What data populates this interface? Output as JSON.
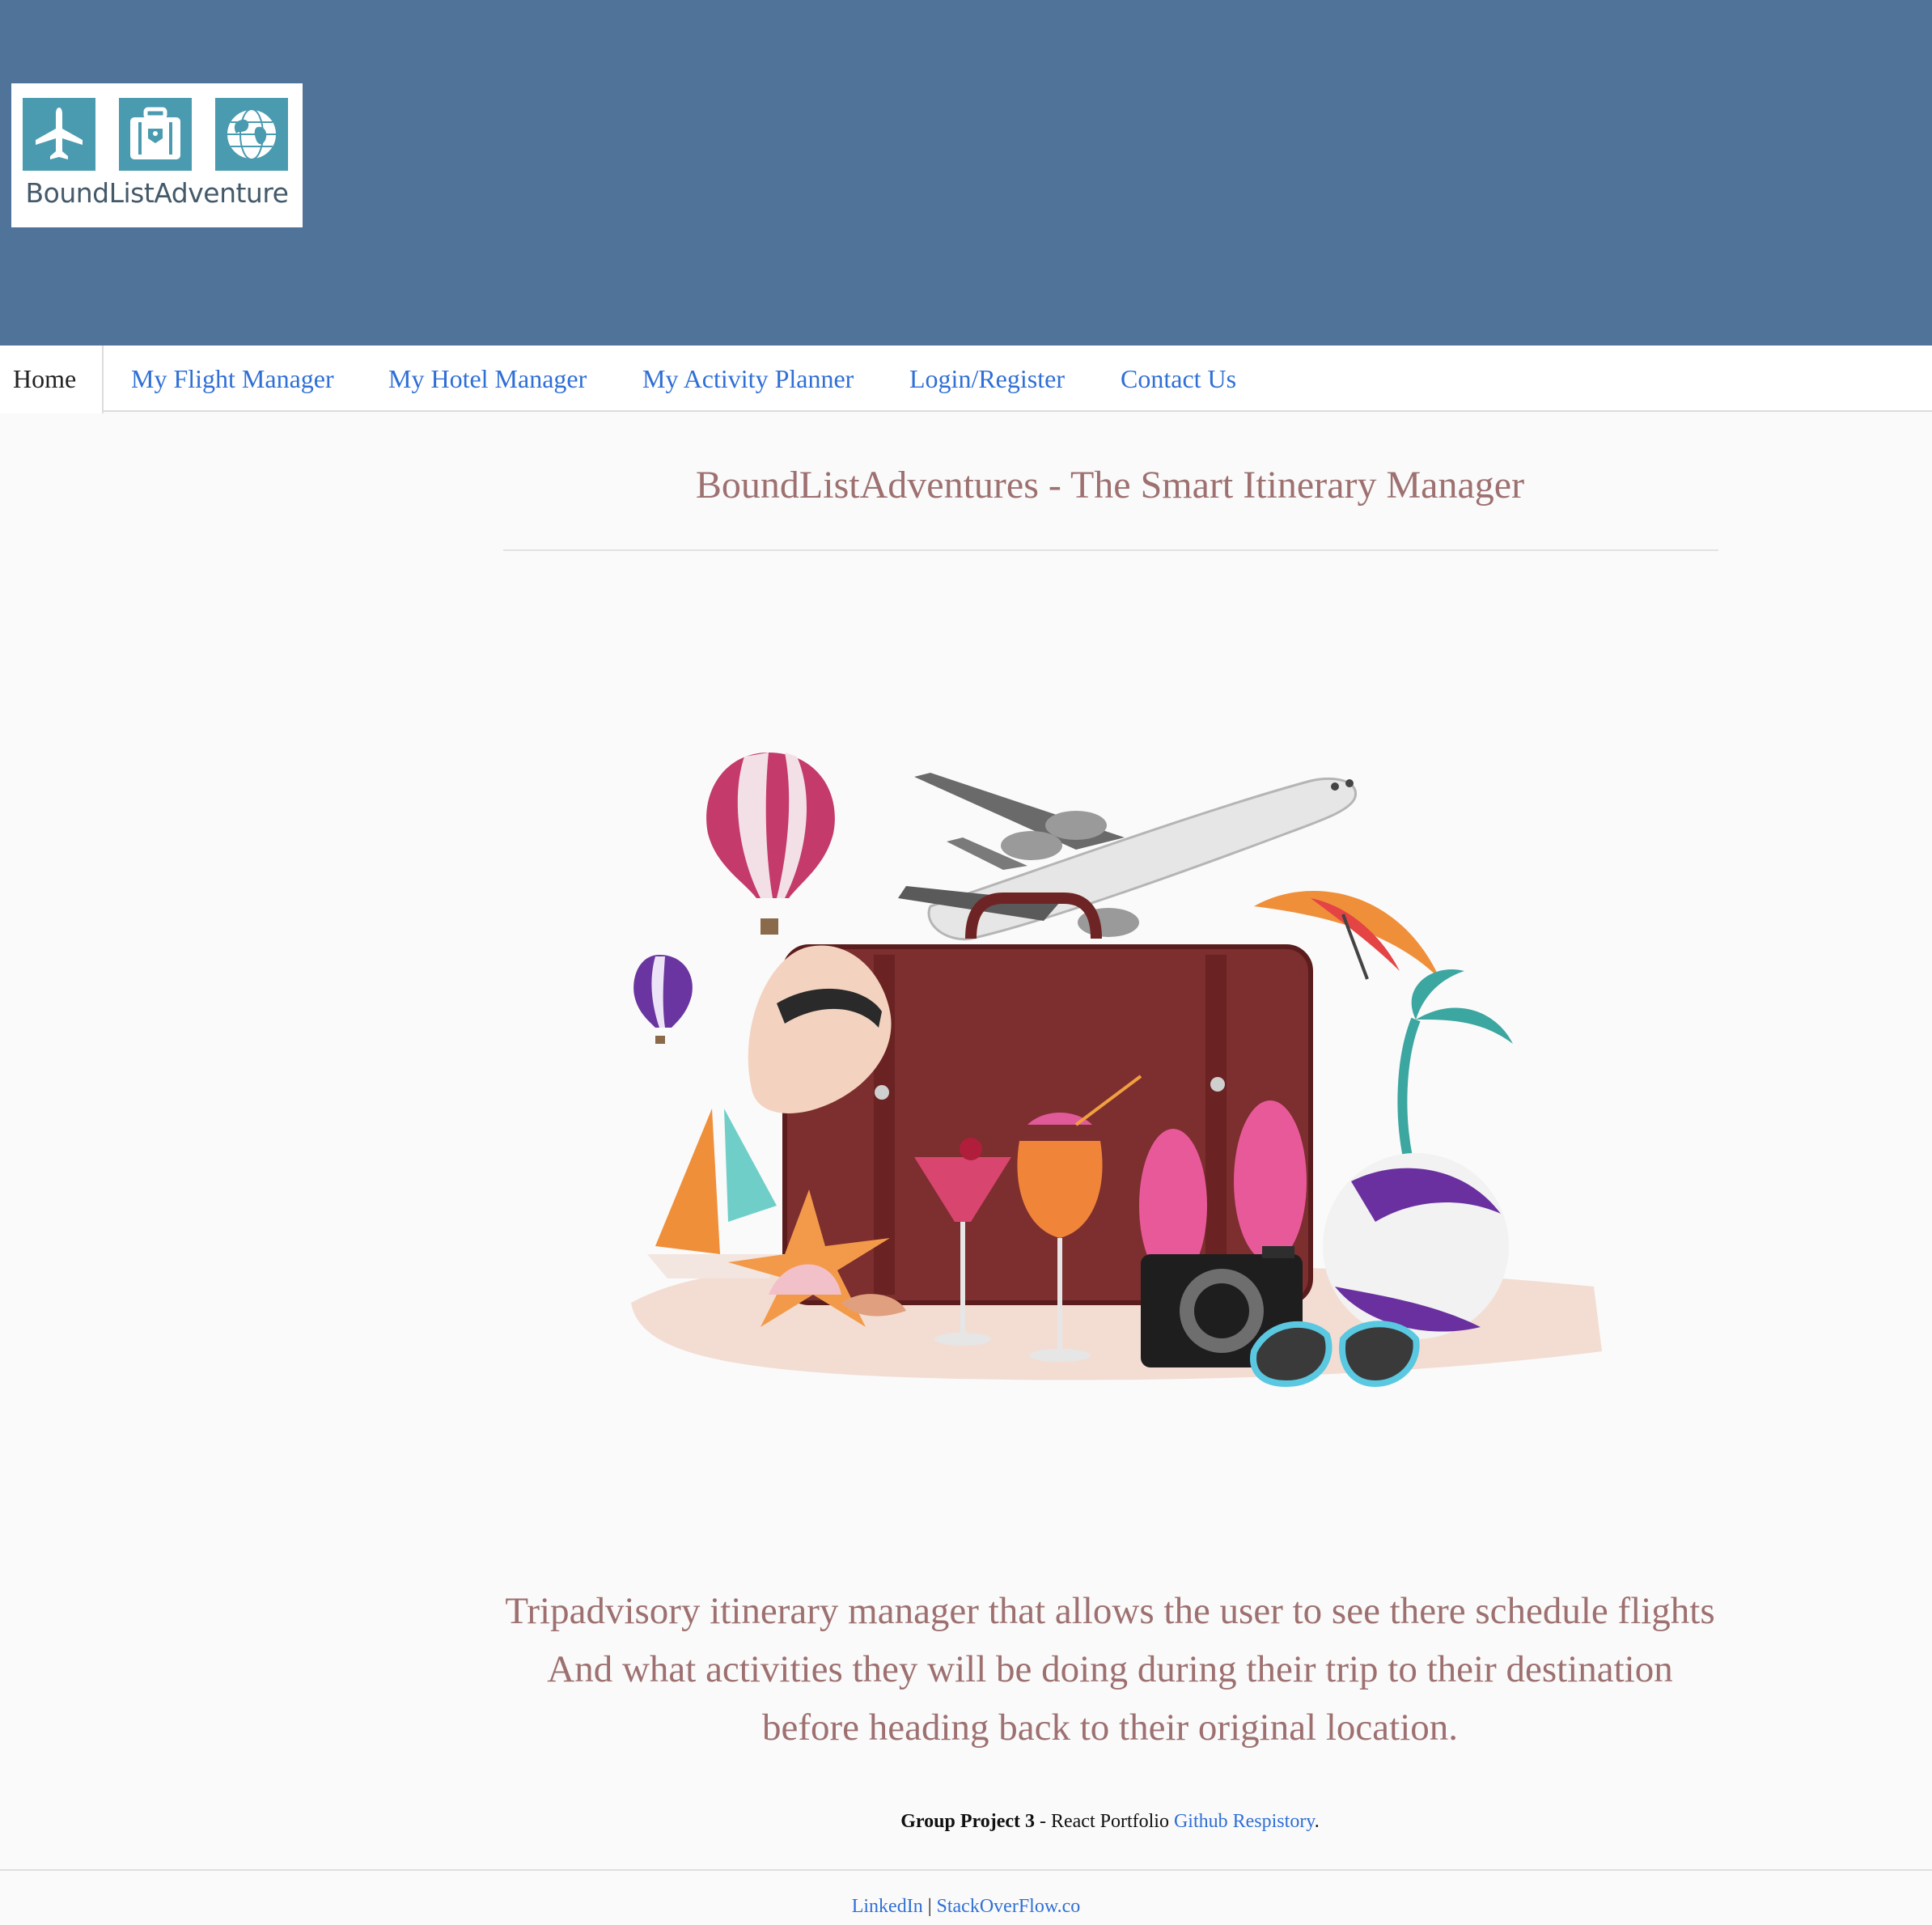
{
  "header": {
    "logo_text": "BoundListAdventure",
    "background": "#507399",
    "logo_icons": [
      "airplane-icon",
      "suitcase-icon",
      "globe-icon"
    ]
  },
  "nav": {
    "tabs": [
      {
        "label": "Home",
        "active": true
      },
      {
        "label": "My Flight Manager"
      },
      {
        "label": "My Hotel Manager"
      },
      {
        "label": "My Activity Planner"
      },
      {
        "label": "Login/Register"
      },
      {
        "label": "Contact Us"
      }
    ],
    "link_color": "#2f6fd6"
  },
  "main": {
    "title": "BoundListAdventures - The Smart Itinerary Manager",
    "description": "Tripadvisory itinerary manager that allows the user to see there schedule flights And what activities they will be doing during their trip to their destination before heading back to their original location.",
    "accent_text_color": "#9e7070"
  },
  "credit": {
    "bold": "Group Project 3",
    "text": " - React Portfolio ",
    "link": "Github Respistory",
    "end": "."
  },
  "footer": {
    "link1": "LinkedIn",
    "separator": " | ",
    "link2": "StackOverFlow.co"
  }
}
